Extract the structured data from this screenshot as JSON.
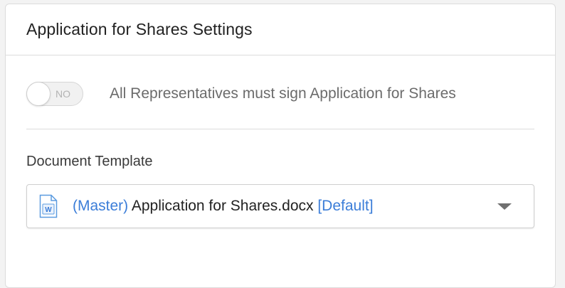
{
  "panel": {
    "title": "Application for Shares Settings"
  },
  "toggle": {
    "state_text": "NO",
    "label": "All Representatives must sign Application for Shares",
    "checked": false
  },
  "document_template": {
    "label": "Document Template",
    "selected": {
      "prefix": "(Master)",
      "filename": "Application for Shares.docx",
      "suffix": "[Default]"
    },
    "icon": "word-document-icon",
    "dropdown_icon": "caret-down-icon"
  },
  "colors": {
    "accent": "#3b7dd8",
    "text_dark": "#222222",
    "text_muted": "#6b6b6b",
    "border": "#dcdcdc"
  }
}
